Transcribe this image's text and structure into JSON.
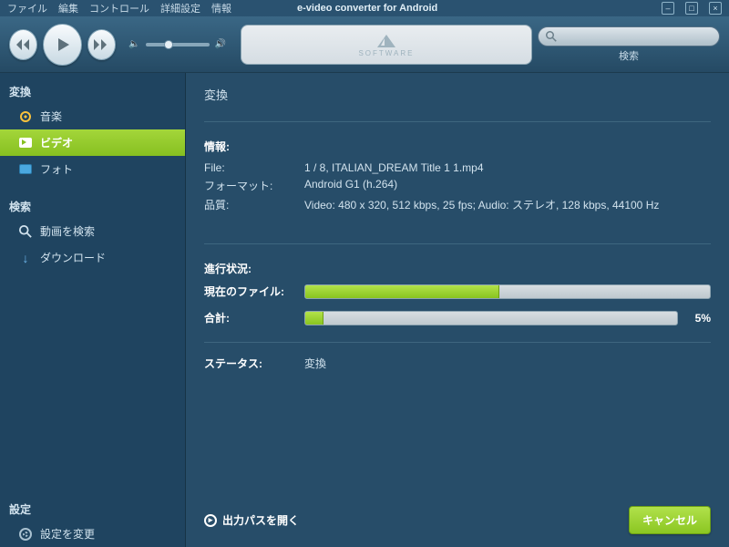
{
  "menu": {
    "file": "ファイル",
    "edit": "編集",
    "control": "コントロール",
    "advanced": "詳細設定",
    "info": "情報",
    "title": "e-video converter for Android"
  },
  "search": {
    "label": "検索"
  },
  "sidebar": {
    "convert": "変換",
    "items": [
      {
        "label": "音楽"
      },
      {
        "label": "ビデオ"
      },
      {
        "label": "フォト"
      }
    ],
    "search": "検索",
    "searchItems": [
      {
        "label": "動画を検索"
      },
      {
        "label": "ダウンロード"
      }
    ],
    "settings": "設定",
    "settingsItem": "設定を変更"
  },
  "main": {
    "title": "変換",
    "infoLabel": "情報:",
    "rows": [
      {
        "k": "File:",
        "v": "1 / 8, ITALIAN_DREAM Title 1 1.mp4"
      },
      {
        "k": "フォーマット:",
        "v": "Android G1 (h.264)"
      },
      {
        "k": "品質:",
        "v": "Video: 480 x 320, 512 kbps, 25 fps; Audio: ステレオ, 128 kbps, 44100 Hz"
      }
    ],
    "progressLabel": "進行状況:",
    "current": {
      "label": "現在のファイル:",
      "pct": 48
    },
    "total": {
      "label": "合計:",
      "pct": 5,
      "text": "5%"
    },
    "statusLabel": "ステータス:",
    "statusValue": "変換",
    "openOutput": "出力パスを開く",
    "cancel": "キャンセル"
  }
}
